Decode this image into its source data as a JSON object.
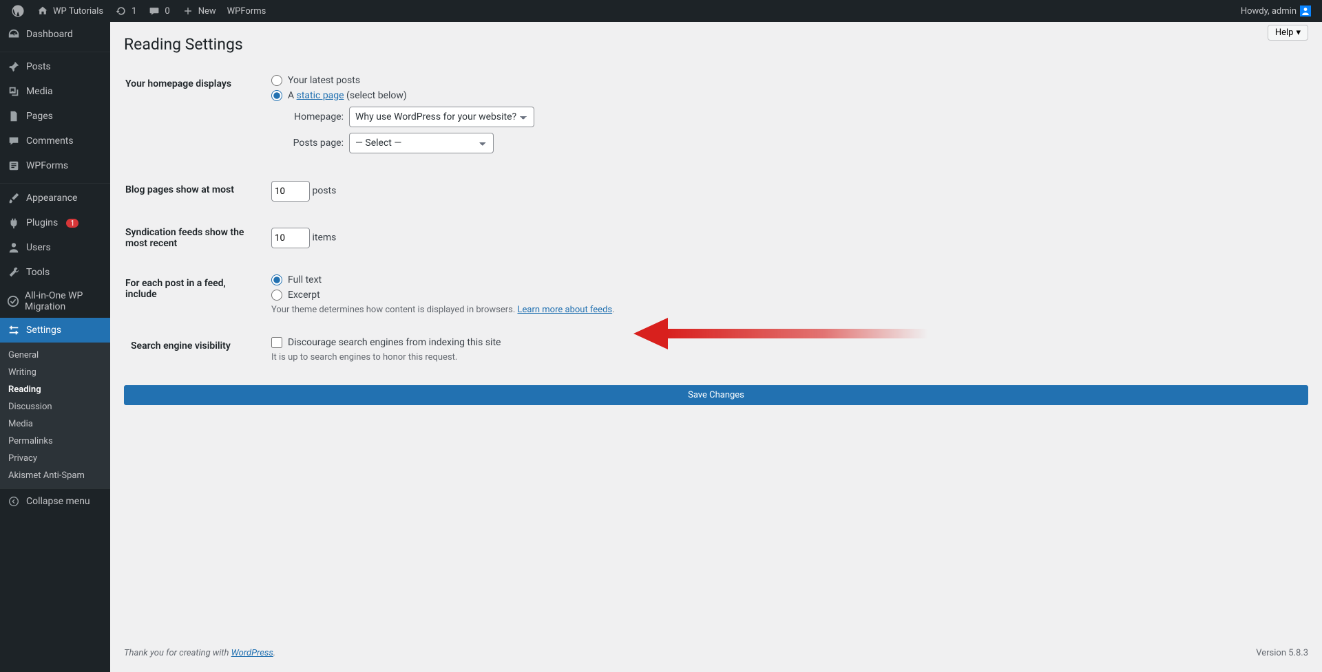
{
  "toolbar": {
    "site_title": "WP Tutorials",
    "updates_count": "1",
    "comments_count": "0",
    "new_label": "New",
    "wpforms_label": "WPForms",
    "howdy": "Howdy, admin"
  },
  "sidebar": {
    "items": [
      {
        "label": "Dashboard"
      },
      {
        "label": "Posts"
      },
      {
        "label": "Media"
      },
      {
        "label": "Pages"
      },
      {
        "label": "Comments"
      },
      {
        "label": "WPForms"
      },
      {
        "label": "Appearance"
      },
      {
        "label": "Plugins",
        "badge": "1"
      },
      {
        "label": "Users"
      },
      {
        "label": "Tools"
      },
      {
        "label": "All-in-One WP Migration"
      },
      {
        "label": "Settings"
      }
    ],
    "submenu": [
      {
        "label": "General"
      },
      {
        "label": "Writing"
      },
      {
        "label": "Reading"
      },
      {
        "label": "Discussion"
      },
      {
        "label": "Media"
      },
      {
        "label": "Permalinks"
      },
      {
        "label": "Privacy"
      },
      {
        "label": "Akismet Anti-Spam"
      }
    ],
    "collapse_label": "Collapse menu"
  },
  "page": {
    "help_label": "Help",
    "title": "Reading Settings",
    "homepage_displays_label": "Your homepage displays",
    "radio_latest": "Your latest posts",
    "radio_static_prefix": "A ",
    "radio_static_link": "static page",
    "radio_static_suffix": " (select below)",
    "homepage_label": "Homepage:",
    "homepage_value": "Why use WordPress for your website?",
    "posts_page_label": "Posts page:",
    "posts_page_value": "— Select —",
    "blog_pages_label": "Blog pages show at most",
    "blog_pages_value": "10",
    "blog_pages_unit": "posts",
    "syndication_label": "Syndication feeds show the most recent",
    "syndication_value": "10",
    "syndication_unit": "items",
    "feed_include_label": "For each post in a feed, include",
    "feed_full": "Full text",
    "feed_excerpt": "Excerpt",
    "feed_desc_prefix": "Your theme determines how content is displayed in browsers. ",
    "feed_desc_link": "Learn more about feeds",
    "search_vis_label": "Search engine visibility",
    "search_checkbox_label": "Discourage search engines from indexing this site",
    "search_desc": "It is up to search engines to honor this request.",
    "save_label": "Save Changes"
  },
  "footer": {
    "thanks_prefix": "Thank you for creating with ",
    "thanks_link": "WordPress",
    "thanks_suffix": ".",
    "version": "Version 5.8.3"
  }
}
